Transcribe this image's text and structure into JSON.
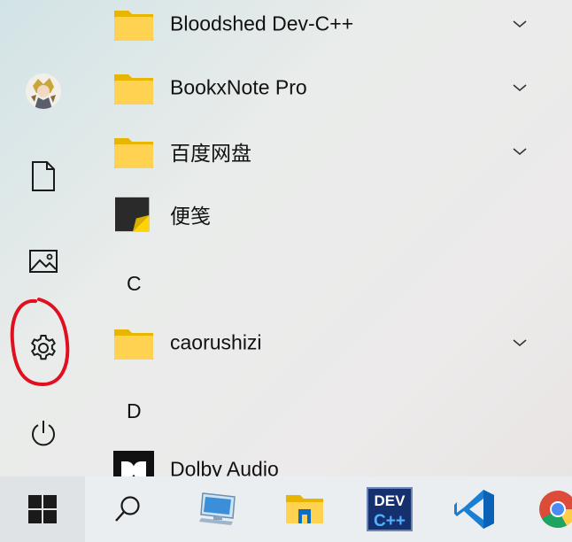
{
  "colors": {
    "folder_back": "#e8b600",
    "folder_front": "#ffd251",
    "highlight_red": "#e01020",
    "accent_blue": "#0a6cc7"
  },
  "left_rail": {
    "items": [
      {
        "name": "user-avatar",
        "icon": "anime-avatar"
      },
      {
        "name": "documents",
        "icon": "document-icon"
      },
      {
        "name": "pictures",
        "icon": "image-icon"
      },
      {
        "name": "settings",
        "icon": "gear-icon",
        "highlighted": true
      },
      {
        "name": "power",
        "icon": "power-icon"
      }
    ]
  },
  "app_list": {
    "items": [
      {
        "type": "folder",
        "label": "Bloodshed Dev-C++",
        "expandable": true
      },
      {
        "type": "folder",
        "label": "BookxNote Pro",
        "expandable": true
      },
      {
        "type": "folder",
        "label": "百度网盘",
        "expandable": true
      },
      {
        "type": "app",
        "label": "便笺",
        "icon": "sticky-notes-icon"
      },
      {
        "type": "letter",
        "label": "C"
      },
      {
        "type": "folder",
        "label": "caorushizi",
        "expandable": true
      },
      {
        "type": "letter",
        "label": "D"
      },
      {
        "type": "app",
        "label": "Dolby Audio",
        "icon": "dolby-icon"
      }
    ]
  },
  "taskbar": {
    "items": [
      {
        "name": "start",
        "icon": "windows-logo-icon"
      },
      {
        "name": "search",
        "icon": "search-icon"
      },
      {
        "name": "this-pc",
        "icon": "computer-icon"
      },
      {
        "name": "file-explorer",
        "icon": "folder-icon"
      },
      {
        "name": "dev-cpp",
        "icon": "devcpp-icon",
        "text_top": "DEV",
        "text_bottom": "C++"
      },
      {
        "name": "vscode",
        "icon": "vscode-icon"
      },
      {
        "name": "chrome",
        "icon": "chrome-icon"
      }
    ]
  }
}
